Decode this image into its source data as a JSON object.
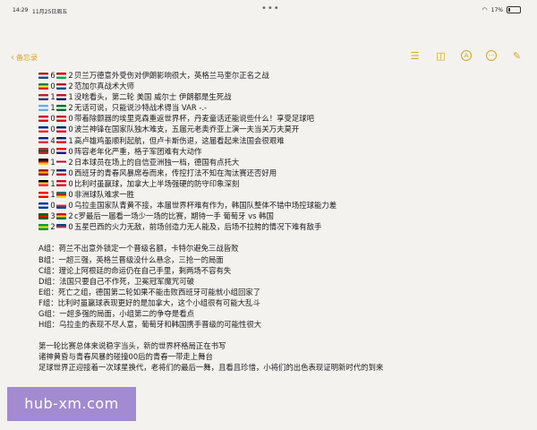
{
  "status": {
    "time": "14:29",
    "date": "11月25日周五",
    "battery": "17%",
    "battery_level": 0.17,
    "wifi_icon": "wifi-icon"
  },
  "toolbar": {
    "back_label": "备忘录",
    "icons": [
      "checklist-icon",
      "camera-icon",
      "markup-icon",
      "more-icon",
      "compose-icon"
    ]
  },
  "accent_color": "#d9a420",
  "matches": [
    {
      "flag_a": [
        "#ae1c28",
        "#ffffff",
        "#21468b"
      ],
      "score_a": "6",
      "flag_b": [
        "#cc0000",
        "#ffffff",
        "#00a651"
      ],
      "score_b": "2",
      "text": "贝兰万德意外受伤对伊朗影响很大，英格兰马奎尔正名之战"
    },
    {
      "flag_a": [
        "#00853f",
        "#fdef42",
        "#e31b23"
      ],
      "score_a": "0",
      "flag_b": [
        "#ae1c28",
        "#ffffff",
        "#21468b"
      ],
      "score_b": "2",
      "text": "范加尔真战术大师"
    },
    {
      "flag_a": [
        "#b22234",
        "#ffffff",
        "#3c3b6e"
      ],
      "score_a": "1",
      "flag_b": [
        "#c8102e",
        "#ffffff",
        "#012169"
      ],
      "score_b": "1",
      "text": "没啥看头，第二轮 美国 威尔士 伊朗都是生死战"
    },
    {
      "flag_a": [
        "#6cace4",
        "#ffffff",
        "#6cace4"
      ],
      "score_a": "1",
      "flag_b": [
        "#006c35",
        "#ffffff",
        "#006c35"
      ],
      "score_b": "2",
      "text": "无话可说，只能说沙特战术得当 VAR -.-"
    },
    {
      "flag_a": [
        "#ce1126",
        "#ffffff",
        "#ce1126"
      ],
      "score_a": "0",
      "flag_b": [
        "#ce1126",
        "#ffffff",
        "#ce1126"
      ],
      "score_b": "0",
      "text": "带着除颤器的埃里克森重返世界杯，丹麦童话还能说些什么！享受足球吧"
    },
    {
      "flag_a": [
        "#002395",
        "#ffffff",
        "#ed2939"
      ],
      "score_a": "0",
      "flag_b": [
        "#012169",
        "#ffffff",
        "#e4002b"
      ],
      "score_b": "0",
      "text": "波兰神锋在国家队独木难支，五届元老奥乔亚上演一夫当关万夫莫开"
    },
    {
      "flag_a": [
        "#002395",
        "#ffffff",
        "#ed2939"
      ],
      "score_a": "4",
      "flag_b": [
        "#012169",
        "#ffffff",
        "#e4002b"
      ],
      "score_b": "1",
      "text": "高卢雄鸡虽顺利起航，但卢卡斯伤退，这届看起来法国会很艰难"
    },
    {
      "flag_a": [
        "#c1272d",
        "#006233",
        "#c1272d"
      ],
      "score_a": "0",
      "flag_b": [
        "#ff0000",
        "#ffffff",
        "#171796"
      ],
      "score_b": "0",
      "text": "阵容老年化严重，格子军团难有大动作"
    },
    {
      "flag_a": [
        "#000000",
        "#dd0000",
        "#ffce00"
      ],
      "score_a": "1",
      "flag_b": [
        "#ffffff",
        "#bc002d",
        "#ffffff"
      ],
      "score_b": "2",
      "text": "日本球员在场上的自信亚洲独一档，德国有点托大"
    },
    {
      "flag_a": [
        "#aa151b",
        "#f1bf00",
        "#aa151b"
      ],
      "score_a": "7",
      "flag_b": [
        "#002b7f",
        "#ffffff",
        "#ce1126"
      ],
      "score_b": "0",
      "text": "西班牙的青春风暴席卷而来，传控打法不知在淘汰赛还否好用"
    },
    {
      "flag_a": [
        "#000000",
        "#fdda24",
        "#ef3340"
      ],
      "score_a": "1",
      "flag_b": [
        "#d80621",
        "#ffffff",
        "#d80621"
      ],
      "score_b": "0",
      "text": "比利时虽赢球，加拿大上半场强硬的防守印象深刻"
    },
    {
      "flag_a": [
        "#ff0000",
        "#ffffff",
        "#ff0000"
      ],
      "score_a": "1",
      "flag_b": [
        "#007a5e",
        "#ce1126",
        "#fcd116"
      ],
      "score_b": "0",
      "text": "非洲球队难求一胜"
    },
    {
      "flag_a": [
        "#0038a8",
        "#ffffff",
        "#0038a8"
      ],
      "score_a": "0",
      "flag_b": [
        "#ffffff",
        "#cd2e3a",
        "#0047a0"
      ],
      "score_b": "0",
      "text": "乌拉圭国家队青黄不接，本届世界杯难有作为，韩国队整体不错中场控球能力差"
    },
    {
      "flag_a": [
        "#006600",
        "#ff0000",
        "#006600"
      ],
      "score_a": "3",
      "flag_b": [
        "#ce1126",
        "#fcd116",
        "#006b3f"
      ],
      "score_b": "2",
      "text": "c罗最后一届看一场少一场的比赛，期待一手 葡萄牙 vs 韩国"
    },
    {
      "flag_a": [
        "#009c3b",
        "#ffdf00",
        "#009c3b"
      ],
      "score_a": "2",
      "flag_b": [
        "#0c4076",
        "#c6363c",
        "#ffffff"
      ],
      "score_b": "0",
      "text": "五星巴西的火力无敌，前场创造力无人能及，后场不拉胯的情况下难有敌手"
    }
  ],
  "groups": [
    "A组：荷兰不出意外锁定一个晋级名额，卡特尔避免三战皆败",
    "B组：一超三强，英格兰晋级没什么悬念，三抢一的局面",
    "C组：理论上阿根廷的命运仍在自己手里，剩两场不容有失",
    "D组：法国只要自己不作死，卫冕冠军魔咒可破",
    "E组：死亡之组，德国第二轮如果不能击败西班牙可能就小组回家了",
    "F组：比利时虽赢球表现更好的是加拿大，这个小组很有可能大乱斗",
    "G组：一超多强的局面，小组第二的争夺是看点",
    "H组：乌拉圭的表现不尽人意，葡萄牙和韩国携手晋级的可能性很大"
  ],
  "summary": [
    "第一轮比赛总体来说稳字当头，新的世界杯格局正在书写",
    "诸神黄昏与青春风暴的碰撞00后的青春一带走上舞台",
    "足球世界正迎接着一次球星换代，老将们的最后一舞，且看且珍惜，小将们的出色表现证明新时代的到来"
  ],
  "watermark": "hub-xm.com"
}
